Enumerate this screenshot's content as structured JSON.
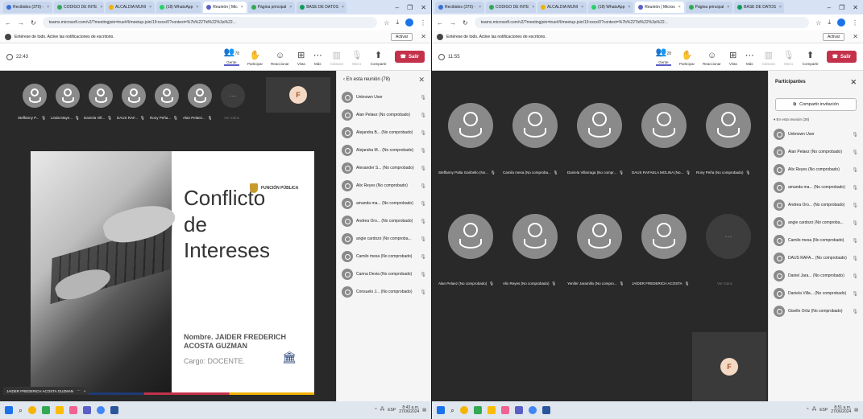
{
  "left": {
    "tabs": [
      {
        "label": "Recibidos (370) -",
        "active": false
      },
      {
        "label": "CODIGO DE INTE",
        "active": false
      },
      {
        "label": "ALCALDIA MUNI",
        "active": false
      },
      {
        "label": "(18) WhatsApp",
        "active": false
      },
      {
        "label": "Reunión | Mic",
        "active": true
      },
      {
        "label": "Página principal",
        "active": false
      },
      {
        "label": "BASE DE DATOS",
        "active": false
      }
    ],
    "url": "teams.microsoft.com/v2/?meetingjoin=true#/l/meetup-join/19:xxxx/0?context=%7b%22Tid%22%3a%22...",
    "notif": {
      "text": "Entérese de todo. Active las notificaciones de escritorio.",
      "button": "Activar"
    },
    "timer": "22:43",
    "people_count": "78",
    "toolbar": [
      "Gente",
      "Participar",
      "Reaccionar",
      "Vista",
      "Más",
      "Cámara",
      "Micro",
      "Compartir"
    ],
    "leave": "Salir",
    "avatars": [
      {
        "name": "Steffanny P..."
      },
      {
        "name": "Linda Maye..."
      },
      {
        "name": "Daniela Vill..."
      },
      {
        "name": "DAUS RAF..."
      },
      {
        "name": "Rony Peña..."
      },
      {
        "name": "Alan Pelaez..."
      }
    ],
    "more_label": "Ver todos",
    "f_initial": "F",
    "slide": {
      "title_lines": [
        "Conflicto",
        "de",
        "Intereses"
      ],
      "logo": "FUNCIÓN PÚBLICA",
      "name": "Nombre. JAIDER FREDERICH ACOSTA GUZMAN",
      "role": "Cargo: DOCENTE."
    },
    "owner": "JAIDER FREDERICH ACOSTA GUZMAN",
    "panel_title": "En esta reunión (78)",
    "participants": [
      "Unknown User",
      "Alan Pelaez (No comprobado)",
      "Alejandra B... (No comprobado)",
      "Alejandra M... (No comprobado)",
      "Alexander S... (No comprobado)",
      "Alix Reyes (No comprobado)",
      "amanda ma... (No comprobado)",
      "Andrea Oro... (No comprobado)",
      "angie cardozo (No comproba...",
      "Camilo mesa (No comprobado)",
      "Carina Devia (No comprobado)",
      "Consuelo J... (No comprobado)"
    ],
    "tray_time": "8:43 a.m.",
    "tray_date": "27/06/2024",
    "tray_lang": "ESP"
  },
  "right": {
    "tabs": [
      {
        "label": "Recibidos (370) -",
        "active": false
      },
      {
        "label": "CODIGO DE INTE",
        "active": false
      },
      {
        "label": "ALCALDIA MUNI",
        "active": false
      },
      {
        "label": "(18) WhatsApp",
        "active": false
      },
      {
        "label": "Reunión | Micros",
        "active": true
      },
      {
        "label": "Página principal",
        "active": false
      },
      {
        "label": "BASE DE DATOS",
        "active": false
      }
    ],
    "url": "teams.microsoft.com/v2/?meetingjoin=true#/l/meetup-join/19:xxxx/0?context=%7b%22Tid%22%3a%22...",
    "notif": {
      "text": "Entérese de todo. Active las notificaciones de escritorio.",
      "button": "Activar"
    },
    "timer": "11:55",
    "people_count": "28",
    "toolbar": [
      "Gente",
      "Participar",
      "Reaccionar",
      "Vista",
      "Más",
      "Cámara",
      "Micro",
      "Compartir"
    ],
    "leave": "Salir",
    "grid": [
      {
        "name": "Steffanny Palta Garibello (No..."
      },
      {
        "name": "Camilo mesa (No comproba..."
      },
      {
        "name": "Daniela Villarraga (No compr..."
      },
      {
        "name": "DAUS RAFAELA MOLINA (No..."
      },
      {
        "name": "Rony Peña (No comprobado)"
      },
      {
        "name": "Alan Pelaez (No comprobado)"
      },
      {
        "name": "Alix Reyes (No comprobado)"
      },
      {
        "name": "Yenifer Jaramillo (No compro..."
      },
      {
        "name": "JAIDER FREDERICH ACOSTA"
      }
    ],
    "more_label": "Ver todos",
    "f_initial": "F",
    "panel_title": "Participantes",
    "invite": "Compartir invitación",
    "section": "En esta reunión (28)",
    "participants": [
      "Unknown User",
      "Alan Pelaez (No comprobado)",
      "Alix Reyes (No comprobado)",
      "amanda ma... (No comprobado)",
      "Andrea Oro... (No comprobado)",
      "angie cardozo (No comproba...",
      "Camilo mesa (No comprobado)",
      "DAUS RAFA... (No comprobado)",
      "Daniel Jara... (No comprobado)",
      "Daniela Villa... (No comprobado)",
      "Giselle Ortiz (No comprobado)"
    ],
    "tray_time": "8:51 a.m.",
    "tray_date": "27/06/2024",
    "tray_lang": "ESP"
  }
}
